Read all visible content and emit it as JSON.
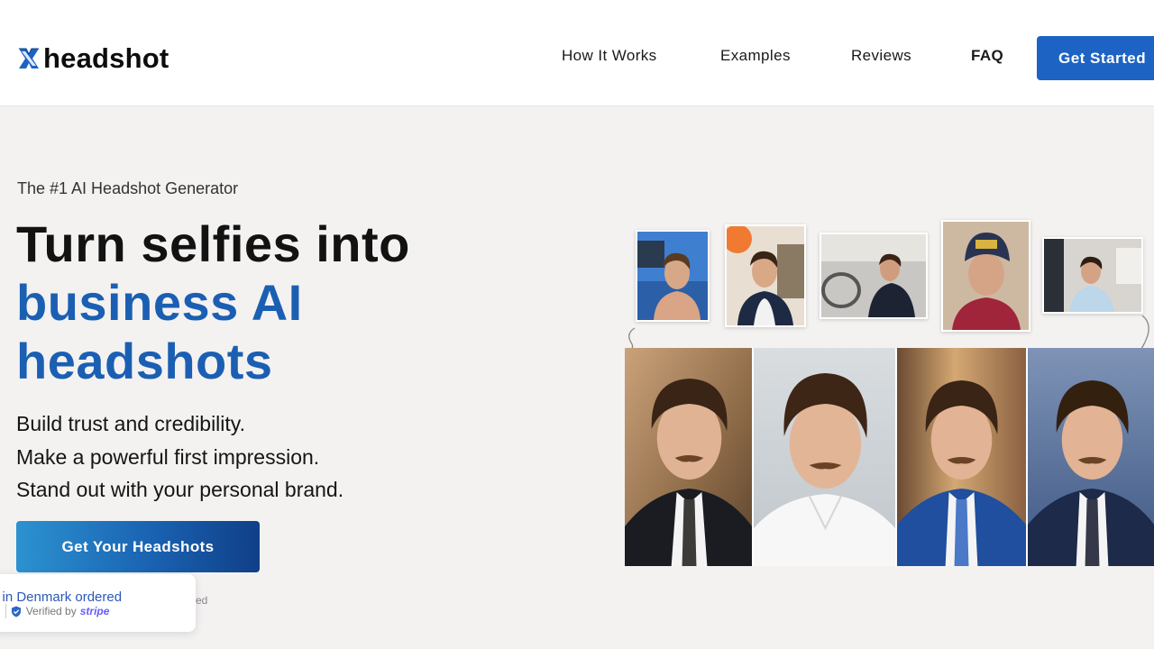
{
  "header": {
    "logo_text": "headshot",
    "nav": {
      "how": "How It Works",
      "examples": "Examples",
      "reviews": "Reviews",
      "faq": "FAQ"
    },
    "cta": "Get Started"
  },
  "hero": {
    "eyebrow": "The #1 AI Headshot Generator",
    "headline_line1": "Turn selfies into",
    "headline_line2": "business AI",
    "headline_line3": "headshots",
    "tagline": [
      "Build trust and credibility.",
      "Make a powerful first impression.",
      "Stand out with your personal brand."
    ],
    "cta": "Get Your Headshots"
  },
  "toast": {
    "message": "e in Denmark ordered",
    "prefix": "o",
    "verified": "Verified by",
    "brand": "stripe"
  },
  "behind_toast_text": "ed",
  "colors": {
    "accent": "#1d63c4",
    "headline_blue": "#1b5fb3",
    "page_bg": "#f3f2f1"
  },
  "icons": [
    "logo-x-icon",
    "shield-check-icon",
    "curved-arrow-icon"
  ]
}
